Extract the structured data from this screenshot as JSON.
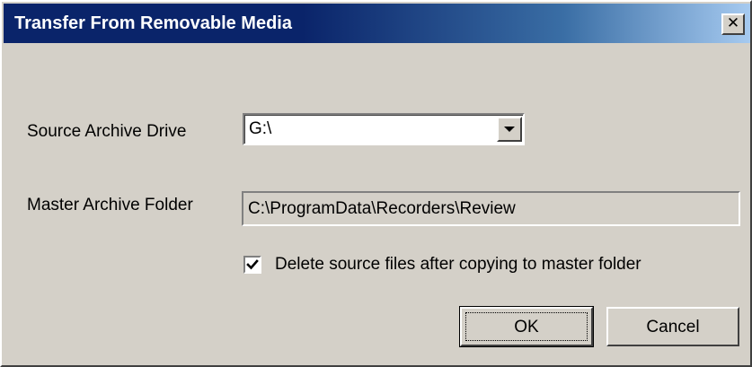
{
  "window": {
    "title": "Transfer From Removable Media",
    "close_glyph": "✕"
  },
  "source_drive": {
    "label": "Source Archive Drive",
    "value": "G:\\",
    "arrow_icon": "chevron-down-icon"
  },
  "master_folder": {
    "label": "Master Archive Folder",
    "value": "C:\\ProgramData\\Recorders\\Review"
  },
  "delete_option": {
    "checked": true,
    "label": "Delete source files after copying to master folder"
  },
  "buttons": {
    "ok_label": "OK",
    "cancel_label": "Cancel"
  },
  "colors": {
    "titlebar_start": "#0a246a",
    "titlebar_end": "#a6caf0",
    "dialog_face": "#d4d0c8"
  }
}
